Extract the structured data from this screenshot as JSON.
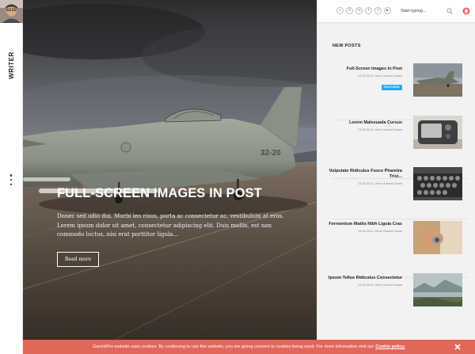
{
  "site": {
    "brand": "WRITER"
  },
  "hero": {
    "title": "FULL-SCREEN IMAGES IN POST",
    "excerpt": "Donec sed odio dui. Morbi leo risus, porta ac consectetur ac, vestibulum at eros. Lorem ipsum dolor sit amet, consectetur adipiscing elit. Duis mollis, est non commodo luctus, nisi erat porttitor ligula...",
    "read_more": "Read more"
  },
  "topbar": {
    "socials": [
      {
        "name": "vimeo-icon",
        "glyph": "v"
      },
      {
        "name": "skype-icon",
        "glyph": "S"
      },
      {
        "name": "linkedin-icon",
        "glyph": "in"
      },
      {
        "name": "twitter-icon",
        "glyph": "t"
      },
      {
        "name": "facebook-icon",
        "glyph": "f"
      },
      {
        "name": "youtube-icon",
        "glyph": "▶"
      }
    ],
    "search_placeholder": "Start typing..."
  },
  "new_posts": {
    "title": "NEW POSTS",
    "items": [
      {
        "title": "Full-Screen Images In Post",
        "meta": "23.05.2014, Devin Samuel Dwart",
        "badge": "FEATURED"
      },
      {
        "title": "Lorem Malesuada Cursus",
        "meta": "23.05.2014, Devin Samuel Dwart",
        "badge": ""
      },
      {
        "title": "Vulputate Ridiculus Fusce Pharetra Trist...",
        "meta": "23.05.2014, Devin Samuel Dwart",
        "badge": ""
      },
      {
        "title": "Fermentum Mattis Nibh Ligula Cras",
        "meta": "23.05.2014, Devin Samuel Dwart",
        "badge": ""
      },
      {
        "title": "Ipsum Tellus Ridiculus Consectetur",
        "meta": "23.05.2014, Devin Samuel Dwart",
        "badge": ""
      }
    ]
  },
  "cookie": {
    "text": "GavickPro website uses cookies. By continuing to use this website, you are giving consent to cookies being used. For more information visit our",
    "link": "Cookie policy."
  },
  "colors": {
    "accent_blue": "#29a9df",
    "cookie_red": "#e2675b"
  }
}
